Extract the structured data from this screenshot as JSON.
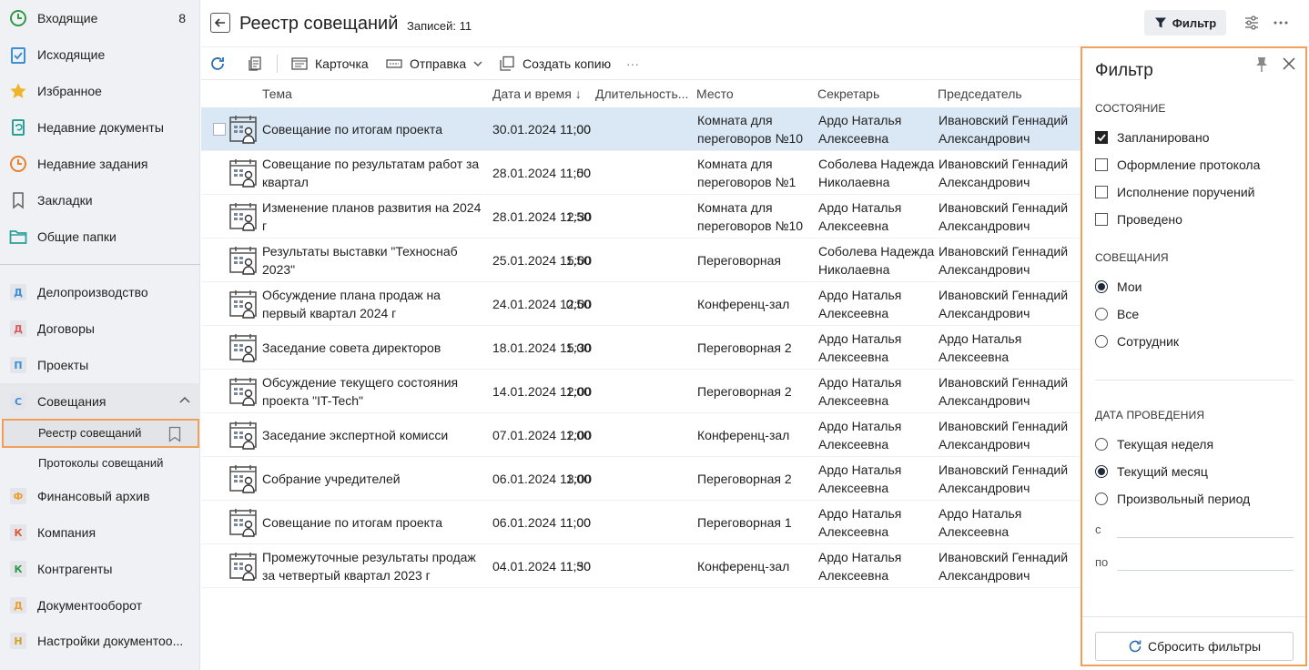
{
  "sidebar": {
    "top_items": [
      {
        "label": "Входящие",
        "count": "8",
        "icon": "clock-green-icon"
      },
      {
        "label": "Исходящие",
        "count": "",
        "icon": "clipboard-check-icon"
      },
      {
        "label": "Избранное",
        "count": "",
        "icon": "star-icon"
      },
      {
        "label": "Недавние документы",
        "count": "",
        "icon": "recent-docs-icon"
      },
      {
        "label": "Недавние задания",
        "count": "",
        "icon": "clock-orange-icon"
      },
      {
        "label": "Закладки",
        "count": "",
        "icon": "bookmark-icon"
      },
      {
        "label": "Общие папки",
        "count": "",
        "icon": "folder-icon"
      }
    ],
    "modules": [
      {
        "letter": "Д",
        "label": "Делопроизводство",
        "color": "#3a8fd6"
      },
      {
        "letter": "Д",
        "label": "Договоры",
        "color": "#e05a5a"
      },
      {
        "letter": "П",
        "label": "Проекты",
        "color": "#3a8fd6"
      },
      {
        "letter": "С",
        "label": "Совещания",
        "color": "#3a8fd6"
      }
    ],
    "sub_items": [
      {
        "label": "Реестр совещаний"
      },
      {
        "label": "Протоколы совещаний"
      }
    ],
    "modules_bottom": [
      {
        "letter": "Ф",
        "label": "Финансовый архив",
        "color": "#f0a030"
      },
      {
        "letter": "К",
        "label": "Компания",
        "color": "#e05a3a"
      },
      {
        "letter": "К",
        "label": "Контрагенты",
        "color": "#2e9a4a"
      },
      {
        "letter": "Д",
        "label": "Документооборот",
        "color": "#f0a030"
      },
      {
        "letter": "Н",
        "label": "Настройки документоо...",
        "color": "#d4a020"
      }
    ]
  },
  "header": {
    "title": "Реестр совещаний",
    "records": "Записей: 11",
    "filter_label": "Фильтр"
  },
  "toolbar": {
    "card": "Карточка",
    "send": "Отправка",
    "copy": "Создать копию",
    "more": "···"
  },
  "table": {
    "columns": [
      "Тема",
      "Дата и время ↓",
      "Длительность...",
      "Место",
      "Секретарь",
      "Председатель"
    ],
    "rows": [
      {
        "topic": [
          "Совещание по итогам проекта"
        ],
        "date": "30.01.2024 11:00",
        "duration": "1,00",
        "place": [
          "Комната для",
          "переговоров №10"
        ],
        "secretary": [
          "Ардо Наталья",
          "Алексеевна"
        ],
        "chair": [
          "Ивановский Геннадий",
          "Александрович"
        ]
      },
      {
        "topic": [
          "Совещание по результатам работ за",
          "квартал"
        ],
        "date": "28.01.2024 11:00",
        "duration": "1,50",
        "place": [
          "Комната для",
          "переговоров №1"
        ],
        "secretary": [
          "Соболева Надежда",
          "Николаевна"
        ],
        "chair": [
          "Ивановский Геннадий",
          "Александрович"
        ]
      },
      {
        "topic": [
          "Изменение планов развития на 2024",
          "г"
        ],
        "date": "28.01.2024 12:30",
        "duration": "1,50",
        "place": [
          "Комната для",
          "переговоров №10"
        ],
        "secretary": [
          "Ардо Наталья",
          "Алексеевна"
        ],
        "chair": [
          "Ивановский Геннадий",
          "Александрович"
        ]
      },
      {
        "topic": [
          "Результаты выставки \"Техноснаб",
          "2023\""
        ],
        "date": "25.01.2024 15:00",
        "duration": "1,50",
        "place": [
          "Переговорная"
        ],
        "secretary": [
          "Соболева Надежда",
          "Николаевна"
        ],
        "chair": [
          "Ивановский Геннадий",
          "Александрович"
        ]
      },
      {
        "topic": [
          "Обсуждение плана продаж на",
          "первый квартал 2024 г"
        ],
        "date": "24.01.2024 12:00",
        "duration": "0,50",
        "place": [
          "Конференц-зал"
        ],
        "secretary": [
          "Ардо Наталья",
          "Алексеевна"
        ],
        "chair": [
          "Ивановский Геннадий",
          "Александрович"
        ]
      },
      {
        "topic": [
          "Заседание совета директоров"
        ],
        "date": "18.01.2024 15:30",
        "duration": "1,00",
        "place": [
          "Переговорная 2"
        ],
        "secretary": [
          "Ардо Наталья",
          "Алексеевна"
        ],
        "chair": [
          "Ардо Наталья",
          "Алексеевна"
        ]
      },
      {
        "topic": [
          "Обсуждение текущего состояния",
          "проекта \"IT-Tech\""
        ],
        "date": "14.01.2024 12:00",
        "duration": "1,00",
        "place": [
          "Переговорная 2"
        ],
        "secretary": [
          "Ардо Наталья",
          "Алексеевна"
        ],
        "chair": [
          "Ивановский Геннадий",
          "Александрович"
        ]
      },
      {
        "topic": [
          "Заседание экспертной комисси"
        ],
        "date": "07.01.2024 12:00",
        "duration": "1,00",
        "place": [
          "Конференц-зал"
        ],
        "secretary": [
          "Ардо Наталья",
          "Алексеевна"
        ],
        "chair": [
          "Ивановский Геннадий",
          "Александрович"
        ]
      },
      {
        "topic": [
          "Собрание учредителей"
        ],
        "date": "06.01.2024 13:00",
        "duration": "1,00",
        "place": [
          "Переговорная 2"
        ],
        "secretary": [
          "Ардо Наталья",
          "Алексеевна"
        ],
        "chair": [
          "Ивановский Геннадий",
          "Александрович"
        ]
      },
      {
        "topic": [
          "Совещание по итогам проекта"
        ],
        "date": "06.01.2024 11:00",
        "duration": "1,00",
        "place": [
          "Переговорная 1"
        ],
        "secretary": [
          "Ардо Наталья",
          "Алексеевна"
        ],
        "chair": [
          "Ардо Наталья",
          "Алексеевна"
        ]
      },
      {
        "topic": [
          "Промежуточные результаты продаж",
          "за четвертый квартал 2023 г"
        ],
        "date": "04.01.2024 11:30",
        "duration": "1,50",
        "place": [
          "Конференц-зал"
        ],
        "secretary": [
          "Ардо Наталья",
          "Алексеевна"
        ],
        "chair": [
          "Ивановский Геннадий",
          "Александрович"
        ]
      }
    ]
  },
  "filter": {
    "title": "Фильтр",
    "state_title": "СОСТОЯНИЕ",
    "states": [
      {
        "label": "Запланировано",
        "checked": true
      },
      {
        "label": "Оформление протокола",
        "checked": false
      },
      {
        "label": "Исполнение поручений",
        "checked": false
      },
      {
        "label": "Проведено",
        "checked": false
      }
    ],
    "meetings_title": "СОВЕЩАНИЯ",
    "meetings": [
      {
        "label": "Мои",
        "selected": true
      },
      {
        "label": "Все",
        "selected": false
      },
      {
        "label": "Сотрудник",
        "selected": false
      }
    ],
    "date_title": "ДАТА ПРОВЕДЕНИЯ",
    "dates": [
      {
        "label": "Текущая неделя",
        "selected": false
      },
      {
        "label": "Текущий месяц",
        "selected": true
      },
      {
        "label": "Произвольный период",
        "selected": false
      }
    ],
    "from_label": "с",
    "to_label": "по",
    "reset_label": "Сбросить фильтры"
  },
  "colors": {
    "accent_outline": "#f0a05a",
    "selected_row": "#dae8f5"
  }
}
